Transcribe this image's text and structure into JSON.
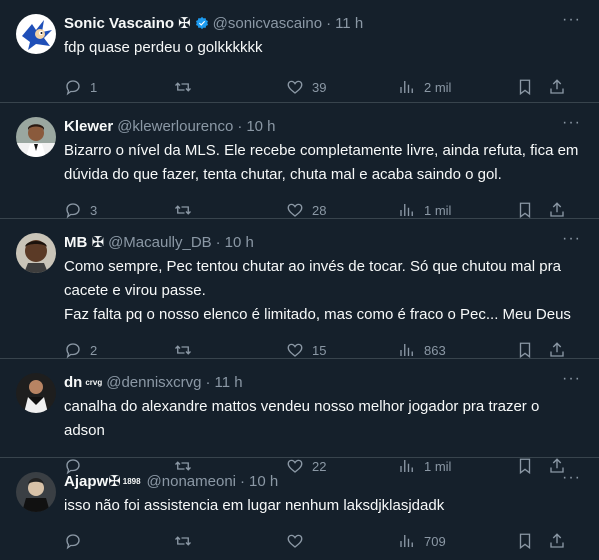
{
  "tweets": [
    {
      "name": "Sonic Vascaino",
      "badge": "✠",
      "verified": true,
      "handle": "@sonicvascaino",
      "time": "11 h",
      "text": "fdp quase perdeu o golkkkkkk",
      "replies": "1",
      "retweets": "",
      "likes": "39",
      "views": "2 mil"
    },
    {
      "name": "Klewer",
      "badge": "",
      "verified": false,
      "handle": "@klewerlourenco",
      "time": "10 h",
      "text": "Bizarro o nível da MLS. Ele recebe completamente livre, ainda refuta, fica em dúvida do que fazer, tenta chutar, chuta mal e acaba saindo o gol.",
      "replies": "3",
      "retweets": "",
      "likes": "28",
      "views": "1 mil"
    },
    {
      "name": "MB ✠",
      "badge": "",
      "verified": false,
      "handle": "@Macaully_DB",
      "time": "10 h",
      "text": "Como sempre, Pec tentou chutar ao invés de tocar. Só que chutou mal pra cacete e virou passe.\nFaz falta pq o nosso elenco é limitado, mas como é fraco o Pec... Meu Deus",
      "replies": "2",
      "retweets": "",
      "likes": "15",
      "views": "863"
    },
    {
      "name": "dn",
      "badge": "crvg",
      "verified": false,
      "handle": "@dennisxcrvg",
      "time": "11 h",
      "text": "canalha do alexandre mattos vendeu nosso melhor jogador pra trazer o adson",
      "replies": "",
      "retweets": "",
      "likes": "22",
      "views": "1 mil"
    },
    {
      "name": "Ajapw✠",
      "badge": "1898",
      "verified": false,
      "handle": "@nonameoni",
      "time": "10 h",
      "text": "isso não foi assistencia em lugar nenhum laksdjklasjdadk",
      "replies": "",
      "retweets": "",
      "likes": "",
      "views": "709"
    }
  ],
  "more_label": "···",
  "dot": "·",
  "colors": {
    "background": "#15202b",
    "text": "#f7f9f9",
    "muted": "#8b98a5",
    "border": "#38444d",
    "verified": "#1d9bf0"
  },
  "icons": [
    "reply-icon",
    "retweet-icon",
    "like-icon",
    "views-icon",
    "bookmark-icon",
    "share-icon",
    "verified-badge-icon",
    "more-icon"
  ]
}
